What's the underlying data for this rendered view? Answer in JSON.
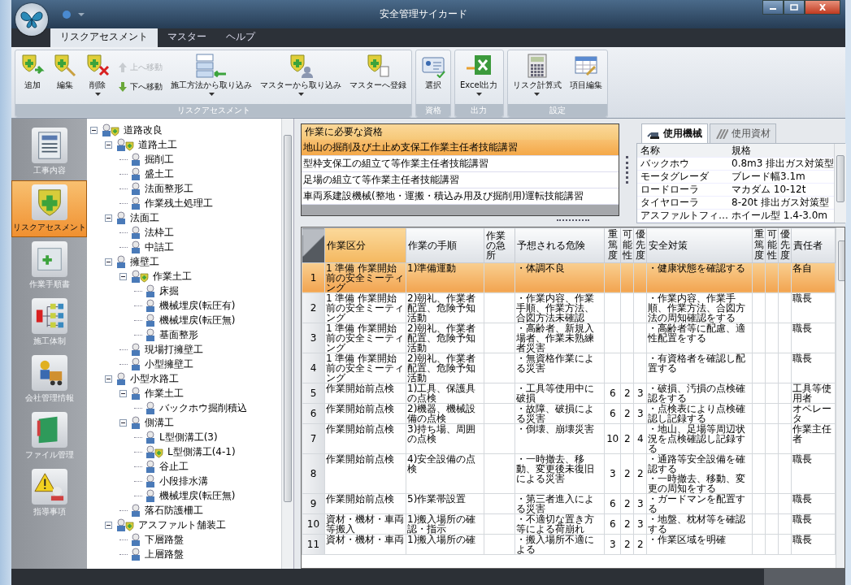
{
  "window": {
    "title": "安全管理サイカード"
  },
  "ribbon_tabs": [
    {
      "label": "リスクアセスメント",
      "selected": true
    },
    {
      "label": "マスター",
      "selected": false
    },
    {
      "label": "ヘルプ",
      "selected": false
    }
  ],
  "ribbon_groups": [
    {
      "label": "リスクアセスメント",
      "buttons": [
        {
          "label": "追加",
          "kind": "large",
          "dropdown": false,
          "disabled": false
        },
        {
          "label": "編集",
          "kind": "large",
          "dropdown": false,
          "disabled": false
        },
        {
          "label": "削除",
          "kind": "large",
          "dropdown": true,
          "disabled": false
        },
        {
          "label": "上へ移動",
          "kind": "small",
          "disabled": true
        },
        {
          "label": "下へ移動",
          "kind": "small",
          "disabled": false
        },
        {
          "label": "施工方法から取り込み",
          "kind": "large",
          "dropdown": true,
          "disabled": false
        },
        {
          "label": "マスターから取り込み",
          "kind": "large",
          "dropdown": true,
          "disabled": false
        },
        {
          "label": "マスターへ登録",
          "kind": "large",
          "dropdown": false,
          "disabled": false
        }
      ]
    },
    {
      "label": "資格",
      "buttons": [
        {
          "label": "選択",
          "kind": "large",
          "dropdown": false,
          "disabled": false
        }
      ]
    },
    {
      "label": "出力",
      "buttons": [
        {
          "label": "Excel出力",
          "kind": "large",
          "dropdown": true,
          "disabled": false
        }
      ]
    },
    {
      "label": "設定",
      "buttons": [
        {
          "label": "リスク計算式",
          "kind": "large",
          "dropdown": true,
          "disabled": false
        },
        {
          "label": "項目編集",
          "kind": "large",
          "dropdown": false,
          "disabled": false
        }
      ]
    }
  ],
  "nav": [
    {
      "label": "工事内容",
      "selected": false
    },
    {
      "label": "リスクアセスメント",
      "selected": true
    },
    {
      "label": "作業手順書",
      "selected": false
    },
    {
      "label": "施工体制",
      "selected": false
    },
    {
      "label": "会社管理情報",
      "selected": false
    },
    {
      "label": "ファイル管理",
      "selected": false
    },
    {
      "label": "指導事項",
      "selected": false
    }
  ],
  "tree": [
    {
      "label": "道路改良",
      "marked": true,
      "expanded": true,
      "children": [
        {
          "label": "道路土工",
          "marked": true,
          "expanded": true,
          "children": [
            {
              "label": "掘削工",
              "marked": false
            },
            {
              "label": "盛土工",
              "marked": false
            },
            {
              "label": "法面整形工",
              "marked": false
            },
            {
              "label": "作業残土処理工",
              "marked": false
            }
          ]
        },
        {
          "label": "法面工",
          "marked": false,
          "expanded": true,
          "children": [
            {
              "label": "法枠工",
              "marked": false
            },
            {
              "label": "中詰工",
              "marked": false
            }
          ]
        },
        {
          "label": "擁壁工",
          "marked": false,
          "expanded": true,
          "children": [
            {
              "label": "作業土工",
              "marked": true,
              "expanded": true,
              "children": [
                {
                  "label": "床掘",
                  "marked": false
                },
                {
                  "label": "機械埋戻(転圧有)",
                  "marked": false
                },
                {
                  "label": "機械埋戻(転圧無)",
                  "marked": false
                },
                {
                  "label": "基面整形",
                  "marked": false
                }
              ]
            },
            {
              "label": "現場打擁壁工",
              "marked": false
            },
            {
              "label": "小型擁壁工",
              "marked": false
            }
          ]
        },
        {
          "label": "小型水路工",
          "marked": false,
          "expanded": true,
          "children": [
            {
              "label": "作業土工",
              "marked": false,
              "expanded": true,
              "children": [
                {
                  "label": "バックホウ掘削積込",
                  "marked": false
                }
              ]
            },
            {
              "label": "側溝工",
              "marked": false,
              "expanded": true,
              "children": [
                {
                  "label": "L型側溝工(3)",
                  "marked": false
                },
                {
                  "label": "L型側溝工(4-1)",
                  "marked": true
                },
                {
                  "label": "谷止工",
                  "marked": false
                },
                {
                  "label": "小段排水溝",
                  "marked": false
                },
                {
                  "label": "機械埋戻(転圧無)",
                  "marked": false
                }
              ]
            },
            {
              "label": "落石防護柵工",
              "marked": false
            }
          ]
        },
        {
          "label": "アスファルト舗装工",
          "marked": true,
          "expanded": true,
          "children": [
            {
              "label": "下層路盤",
              "marked": false
            },
            {
              "label": "上層路盤",
              "marked": false
            }
          ]
        }
      ]
    }
  ],
  "qualifications": {
    "header": "作業に必要な資格",
    "items": [
      {
        "label": "地山の掘削及び土止め支保工作業主任者技能講習",
        "selected": true
      },
      {
        "label": "型枠支保工の組立て等作業主任者技能講習",
        "selected": false
      },
      {
        "label": "足場の組立て等作業主任者技能講習",
        "selected": false
      },
      {
        "label": "車両系建設機械(整地・運搬・積込み用及び掘削用)運転技能講習",
        "selected": false
      }
    ]
  },
  "equipment": {
    "tabs": [
      {
        "label": "使用機械",
        "selected": true
      },
      {
        "label": "使用資材",
        "selected": false
      }
    ],
    "columns": [
      "名称",
      "規格"
    ],
    "rows": [
      {
        "name": "バックホウ",
        "spec": "0.8m3 排出ガス対策型"
      },
      {
        "name": "モータグレーダ",
        "spec": "ブレード幅3.1m"
      },
      {
        "name": "ロードローラ",
        "spec": "マカダム 10-12t"
      },
      {
        "name": "タイヤローラ",
        "spec": "8-20t 排出ガス対策型"
      },
      {
        "name": "アスファルトフィ…",
        "spec": "ホイール型 1.4-3.0m"
      }
    ]
  },
  "risk_table": {
    "columns": [
      {
        "label": "作業区分",
        "kind": "wide",
        "selected": true
      },
      {
        "label": "作業の手順",
        "kind": "wide",
        "selected": false
      },
      {
        "label": "作業の急所",
        "kind": "wide",
        "selected": false
      },
      {
        "label": "予想される危険",
        "kind": "wide",
        "selected": false
      },
      {
        "label": "重篤度",
        "kind": "vertical",
        "selected": false
      },
      {
        "label": "可能性",
        "kind": "vertical",
        "selected": false
      },
      {
        "label": "優先度",
        "kind": "vertical",
        "selected": false
      },
      {
        "label": "安全対策",
        "kind": "wide",
        "selected": false
      },
      {
        "label": "重篤度",
        "kind": "vertical",
        "selected": false
      },
      {
        "label": "可能性",
        "kind": "vertical",
        "selected": false
      },
      {
        "label": "優先度",
        "kind": "vertical",
        "selected": false
      },
      {
        "label": "責任者",
        "kind": "wide",
        "selected": false
      }
    ],
    "rows": [
      {
        "no": "1",
        "selected": true,
        "category": "1 準備 作業開始前の安全ミーティング",
        "step": "1)準備運動",
        "hazard": "・体調不良",
        "measure": "・健康状態を確認する",
        "owner": "各自"
      },
      {
        "no": "2",
        "selected": false,
        "category": "1 準備 作業開始前の安全ミーティング",
        "step": "2)朝礼、作業者配置、危険予知活動",
        "hazard": "・作業内容、作業手順、作業方法、合図方法未確認",
        "measure": "・作業内容、作業手順、作業方法、合図方法の周知確認をする",
        "owner": "職長"
      },
      {
        "no": "3",
        "selected": false,
        "category": "1 準備 作業開始前の安全ミーティング",
        "step": "2)朝礼、作業者配置、危険予知活動",
        "hazard": "・高齢者、新規入場者、作業未熟練者災害",
        "measure": "・高齢者等に配慮、適性配置をする",
        "owner": "職長"
      },
      {
        "no": "4",
        "selected": false,
        "category": "1 準備 作業開始前の安全ミーティング",
        "step": "2)朝礼、作業者配置、危険予知活動",
        "hazard": "・無資格作業による災害",
        "measure": "・有資格者を確認し配置する",
        "owner": "職長"
      },
      {
        "no": "5",
        "selected": false,
        "category": "作業開始前点検",
        "step": "1)工具、保護具の点検",
        "hazard": "・工具等使用中に破損",
        "severity": "6",
        "likelihood": "2",
        "priority": "3",
        "measure": "・破損、汚損の点検確認をする",
        "owner": "工具等使用者"
      },
      {
        "no": "6",
        "selected": false,
        "category": "作業開始前点検",
        "step": "2)機器、機械設備の点検",
        "hazard": "・故障、破損による災害",
        "severity": "6",
        "likelihood": "2",
        "priority": "3",
        "measure": "・点検表により点検確認し記録する",
        "owner": "オペレータ"
      },
      {
        "no": "7",
        "selected": false,
        "category": "作業開始前点検",
        "step": "3)持ち場、周囲の点検",
        "hazard": "・倒壊、崩壊災害",
        "severity": "10",
        "likelihood": "2",
        "priority": "4",
        "measure": "・地山、足場等周辺状況を点検確認し記録する",
        "owner": "作業主任者"
      },
      {
        "no": "8",
        "selected": false,
        "category": "作業開始前点検",
        "step": "4)安全設備の点検",
        "hazard": "・一時撤去、移動、変更後未復旧による災害",
        "severity": "3",
        "likelihood": "2",
        "priority": "2",
        "measure": [
          "・通路等安全設備を確認する",
          "・一時撤去、移動、変更の周知をする"
        ],
        "owner": "職長"
      },
      {
        "no": "9",
        "selected": false,
        "category": "作業開始前点検",
        "step": "5)作業帯設置",
        "hazard": "・第三者進入による災害",
        "severity": "6",
        "likelihood": "2",
        "priority": "3",
        "measure": "・ガードマンを配置する",
        "owner": "職長"
      },
      {
        "no": "10",
        "selected": false,
        "category": "資材・機材・車両等搬入",
        "step": "1)搬入場所の確認・指示",
        "hazard": "・不適切な置き方等による荷崩れ",
        "severity": "6",
        "likelihood": "2",
        "priority": "3",
        "measure": "・地盤、枕材等を確認する",
        "owner": "職長"
      },
      {
        "no": "11",
        "selected": false,
        "category": "資材・機材・車両",
        "step": "1)搬入場所の確",
        "hazard": "・搬入場所不適による",
        "severity": "3",
        "likelihood": "2",
        "priority": "2",
        "measure": "・作業区域を明確",
        "owner": "職長"
      }
    ]
  }
}
